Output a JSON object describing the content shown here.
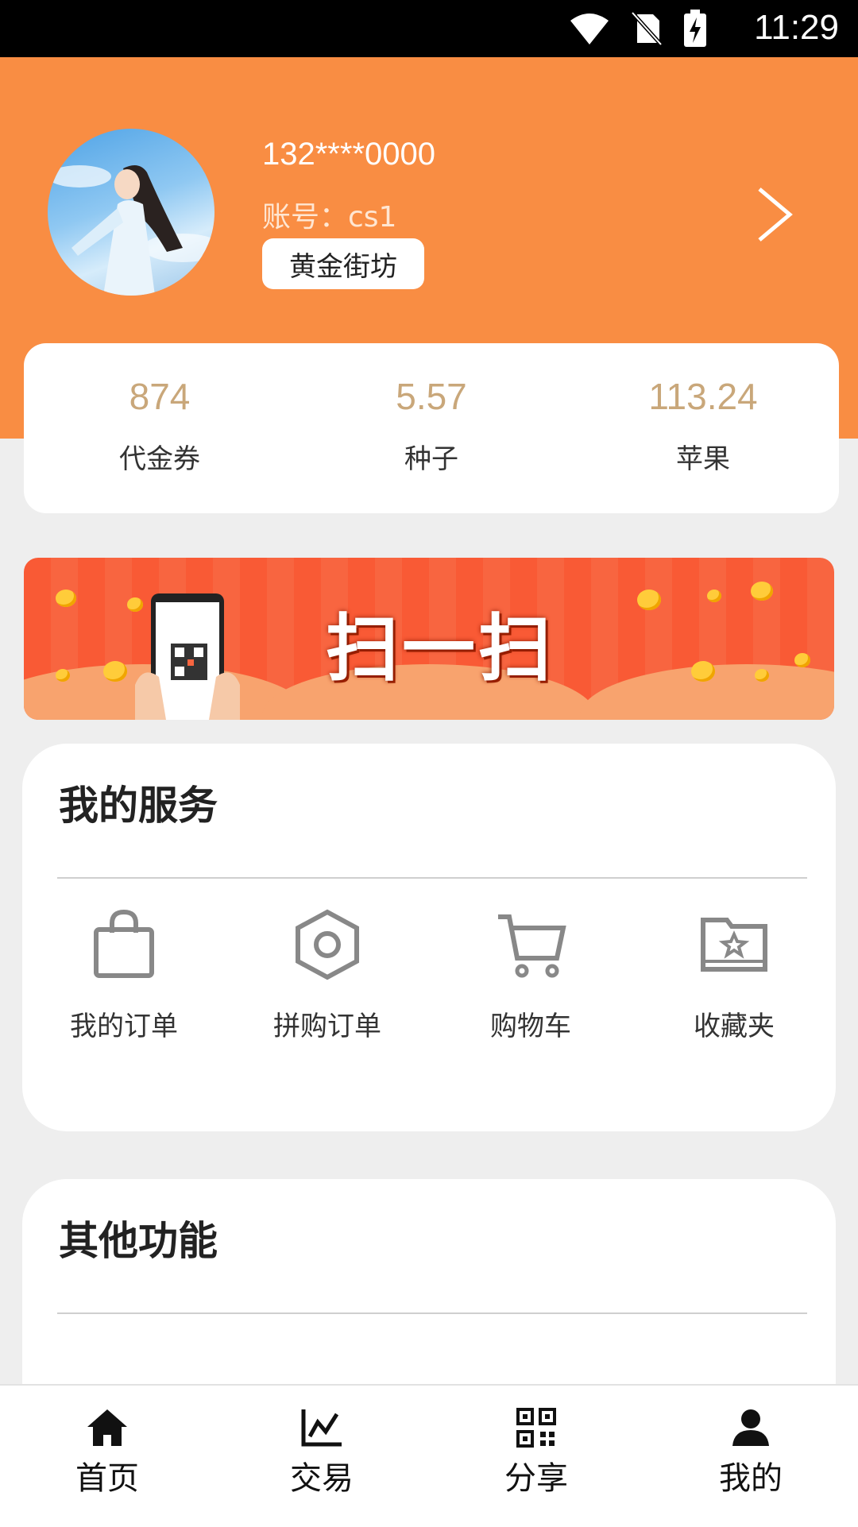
{
  "status_bar": {
    "time": "11:29"
  },
  "profile": {
    "phone": "132****0000",
    "account": "账号：cs1",
    "level_badge": "黄金街坊"
  },
  "stats": [
    {
      "value": "874",
      "label": "代金券"
    },
    {
      "value": "5.57",
      "label": "种子"
    },
    {
      "value": "113.24",
      "label": "苹果"
    }
  ],
  "banner": {
    "title": "扫一扫"
  },
  "services": {
    "title": "我的服务",
    "items": [
      {
        "label": "我的订单",
        "icon": "shopping-bag-icon"
      },
      {
        "label": "拼购订单",
        "icon": "hexagon-icon"
      },
      {
        "label": "购物车",
        "icon": "cart-icon"
      },
      {
        "label": "收藏夹",
        "icon": "star-folder-icon"
      }
    ]
  },
  "other": {
    "title": "其他功能"
  },
  "tabbar": [
    {
      "label": "首页",
      "icon": "home-icon"
    },
    {
      "label": "交易",
      "icon": "chart-icon"
    },
    {
      "label": "分享",
      "icon": "qrcode-icon"
    },
    {
      "label": "我的",
      "icon": "user-icon"
    }
  ]
}
